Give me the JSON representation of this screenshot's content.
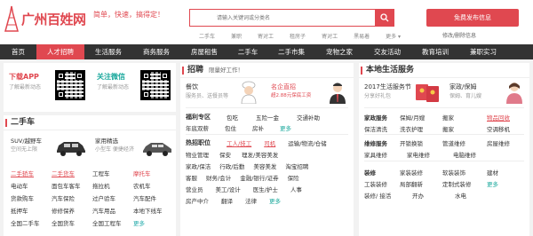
{
  "header": {
    "logo_text": "广州百姓网",
    "slogan": "简单，快速，搞得定！",
    "search_placeholder": "请输入关键词或分类名",
    "hot_words": [
      "二手车",
      "兼职",
      "寄对工",
      "租房子",
      "寄对工",
      "黑易着",
      "更多 ▾"
    ],
    "publish_label": "免费发布信息",
    "header_links": "修改/删除信息"
  },
  "nav": {
    "items": [
      "首页",
      "人才招聘",
      "生活服务",
      "商务服务",
      "房屋租售",
      "二手车",
      "二手市集",
      "宠物之家",
      "交友活动",
      "教育培训",
      "兼职实习"
    ],
    "active_index": 1
  },
  "app_box": {
    "app": {
      "title": "下载APP",
      "sub": "了解最新动态"
    },
    "wechat": {
      "title": "关注微信",
      "sub": "了解最新动态"
    }
  },
  "cars": {
    "title": "二手车",
    "promo1": {
      "title": "SUV/越野车",
      "sub": "空间无上限"
    },
    "promo2": {
      "title": "家用精选",
      "sub": "小型车 便捷经济"
    },
    "links": [
      [
        "二手轿车",
        "二手货车",
        "工程车",
        "摩托车"
      ],
      [
        "电动车",
        "面包车客车",
        "拖拉机",
        "农机车"
      ],
      [
        "货款购车",
        "汽车保险",
        "过户验车",
        "汽车配件"
      ],
      [
        "抵押车",
        "修修保养",
        "汽车用品",
        "本地下线车"
      ],
      [
        "全国二手车",
        "全国货车",
        "全国工程车",
        "更多"
      ]
    ]
  },
  "jobs": {
    "title": "招聘",
    "sub": "限量好工作！",
    "promo1": {
      "title": "餐饮",
      "sub": "服务员、送餐员等"
    },
    "promo2": {
      "title": "名企直招",
      "sub": "超2.88元保底工资"
    },
    "welfare": {
      "label": "福利专区",
      "items": [
        [
          "包吃",
          "五险一金",
          "交通补助"
        ],
        [
          "年底双薪",
          "包住",
          "房补",
          "更多"
        ]
      ]
    },
    "hot": {
      "label": "热招职位",
      "items": [
        [
          "工人/技工",
          "司机",
          "运输/物流/仓储"
        ],
        [
          "物业管理",
          "保安",
          "理发/美容美发"
        ],
        [
          "家政/保洁",
          "行政/后勤",
          "美容美发",
          "淘宝招聘"
        ],
        [
          "客服",
          "财务/会计",
          "金融/银行/证券",
          "保险"
        ],
        [
          "营业员",
          "美工/设计",
          "医生/护士",
          "人事"
        ],
        [
          "房产中介",
          "翻译",
          "法律",
          "更多"
        ]
      ]
    }
  },
  "life": {
    "title": "本地生活服务",
    "promo1": {
      "title": "2017生活服务节",
      "sub": "分享好礼包"
    },
    "promo2": {
      "title": "家政/保姆",
      "sub": "保姆、育儿嫂"
    },
    "rows": [
      {
        "label": "家政服务",
        "items": [
          "保姆/月嫂",
          "搬家",
          "物品回收"
        ],
        "hl": [
          2
        ]
      },
      {
        "label": "",
        "items": [
          "保洁清洗",
          "洗衣护理",
          "搬家",
          "空调移机"
        ]
      },
      {
        "label": "维修服务",
        "items": [
          "开锁换锁",
          "管道维修",
          "房屋维修"
        ]
      },
      {
        "label": "",
        "items": [
          "家具维修",
          "家电维修",
          "电脑维修"
        ]
      },
      {
        "label": "装修",
        "items": [
          "家装装修",
          "软装装饰",
          "建材"
        ]
      },
      {
        "label": "",
        "items": [
          "工装装修",
          "局部翻新",
          "定制式装修",
          "更多"
        ]
      },
      {
        "label": "",
        "items": [
          "装修/ 接活",
          "开办",
          "水电"
        ]
      }
    ]
  },
  "colors": {
    "accent": "#e04850",
    "nav_bg": "#333333",
    "teal": "#1aa89c"
  }
}
